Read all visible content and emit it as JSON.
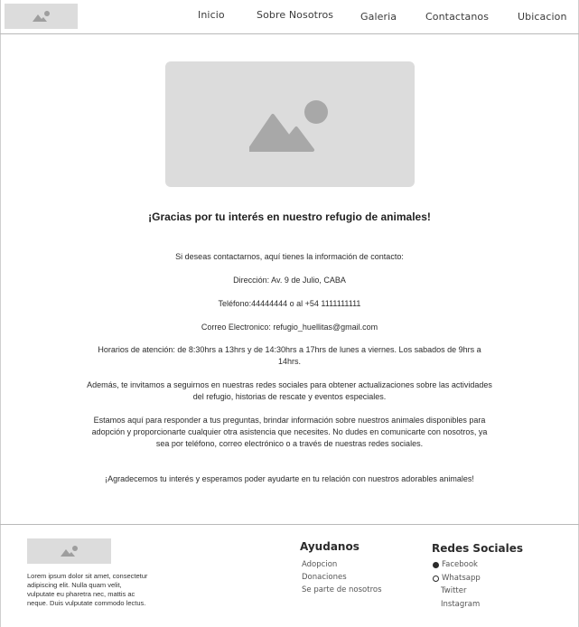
{
  "header": {
    "logo_icon": "image-placeholder-icon",
    "nav": [
      "Inicio",
      "Sobre Nosotros",
      "Galeria",
      "Contactanos",
      "Ubicacion"
    ]
  },
  "main": {
    "hero_icon": "image-placeholder-icon",
    "thanks": "¡Gracias por tu interés en nuestro refugio de animales!",
    "intro": "Si deseas contactarnos, aquí tienes la información de contacto:",
    "address": "Dirección: Av. 9 de Julio, CABA",
    "phone": "Teléfono:44444444 o al +54 1111111111",
    "email": "Correo Electronico: refugio_huellitas@gmail.com",
    "hours": "Horarios de atención: de 8:30hrs a 13hrs y de 14:30hrs a 17hrs de lunes a viernes. Los sabados de 9hrs a 14hrs.",
    "social_invite": "Además, te invitamos a seguirnos en nuestras redes sociales para obtener actualizaciones sobre las actividades del refugio, historias de rescate y eventos especiales.",
    "help": "Estamos aquí para responder a tus preguntas, brindar información sobre nuestros animales disponibles para adopción y proporcionarte cualquier otra asistencia que necesites. No dudes en comunicarte con nosotros, ya sea por teléfono, correo electrónico o a través de nuestras redes sociales.",
    "closing": "¡Agradecemos tu interés y esperamos poder ayudarte en tu relación con nuestros adorables animales!"
  },
  "footer": {
    "logo_icon": "image-placeholder-icon",
    "lorem": "Lorem ipsum dolor sit amet, consectetur adipiscing elit. Nulla quam velit, vulputate eu pharetra nec, mattis ac neque. Duis vulputate commodo lectus.",
    "help_title": "Ayudanos",
    "help_links": [
      "Adopcion",
      "Donaciones",
      "Se parte de nosotros"
    ],
    "social_title": "Redes Sociales",
    "social_links": [
      "Facebook",
      "Whatsapp",
      "Twitter",
      "Instagram"
    ],
    "social_icons": [
      "facebook-icon",
      "whatsapp-icon"
    ]
  }
}
